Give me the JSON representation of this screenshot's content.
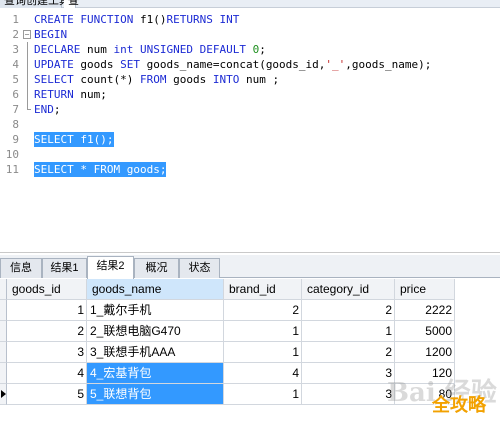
{
  "top_tabs": [
    {
      "label": "查询创建工具"
    },
    {
      "label": "查"
    }
  ],
  "editor": {
    "lines": [
      {
        "n": "1",
        "fold": "none",
        "code": [
          {
            "t": "CREATE FUNCTION",
            "c": "kw"
          },
          {
            "t": " f1()",
            "c": ""
          },
          {
            "t": "RETURNS INT",
            "c": "kw"
          }
        ]
      },
      {
        "n": "2",
        "fold": "box",
        "code": [
          {
            "t": "BEGIN",
            "c": "kw"
          }
        ]
      },
      {
        "n": "3",
        "fold": "vline",
        "code": [
          {
            "t": "DECLARE",
            "c": "kw"
          },
          {
            "t": " num ",
            "c": ""
          },
          {
            "t": "int UNSIGNED DEFAULT",
            "c": "kw"
          },
          {
            "t": " ",
            "c": ""
          },
          {
            "t": "0",
            "c": "num"
          },
          {
            "t": ";",
            "c": ""
          }
        ]
      },
      {
        "n": "4",
        "fold": "vline",
        "code": [
          {
            "t": "UPDATE",
            "c": "kw"
          },
          {
            "t": " goods ",
            "c": ""
          },
          {
            "t": "SET",
            "c": "kw"
          },
          {
            "t": " goods_name=concat(goods_id,",
            "c": ""
          },
          {
            "t": "'_'",
            "c": "str"
          },
          {
            "t": ",goods_name);",
            "c": ""
          }
        ]
      },
      {
        "n": "5",
        "fold": "vline",
        "code": [
          {
            "t": "SELECT",
            "c": "kw"
          },
          {
            "t": " count(*) ",
            "c": ""
          },
          {
            "t": "FROM",
            "c": "kw"
          },
          {
            "t": " goods ",
            "c": ""
          },
          {
            "t": "INTO",
            "c": "kw"
          },
          {
            "t": " num ;",
            "c": ""
          }
        ]
      },
      {
        "n": "6",
        "fold": "vline",
        "code": [
          {
            "t": "RETURN",
            "c": "kw"
          },
          {
            "t": " num;",
            "c": ""
          }
        ]
      },
      {
        "n": "7",
        "fold": "end",
        "code": [
          {
            "t": "END",
            "c": "kw"
          },
          {
            "t": ";",
            "c": ""
          }
        ]
      },
      {
        "n": "8",
        "fold": "none",
        "code": []
      },
      {
        "n": "9",
        "fold": "none",
        "selected": true,
        "code": [
          {
            "t": "SELECT",
            "c": "kw"
          },
          {
            "t": " f1();",
            "c": ""
          }
        ]
      },
      {
        "n": "10",
        "fold": "none",
        "selected": true,
        "code": []
      },
      {
        "n": "11",
        "fold": "none",
        "selected": true,
        "code": [
          {
            "t": "SELECT",
            "c": "kw"
          },
          {
            "t": " * ",
            "c": ""
          },
          {
            "t": "FROM",
            "c": "kw"
          },
          {
            "t": " goods;",
            "c": ""
          }
        ]
      }
    ]
  },
  "result_tabs": [
    {
      "label": "信息",
      "active": false
    },
    {
      "label": "结果1",
      "active": false
    },
    {
      "label": "结果2",
      "active": true
    },
    {
      "label": "概况",
      "active": false
    },
    {
      "label": "状态",
      "active": false
    }
  ],
  "grid": {
    "columns": [
      "goods_id",
      "goods_name",
      "brand_id",
      "category_id",
      "price"
    ],
    "selected_column": "goods_name",
    "rows": [
      {
        "goods_id": "1",
        "goods_name": "1_戴尔手机",
        "brand_id": "2",
        "category_id": "2",
        "price": "2222"
      },
      {
        "goods_id": "2",
        "goods_name": "2_联想电脑G470",
        "brand_id": "1",
        "category_id": "1",
        "price": "5000"
      },
      {
        "goods_id": "3",
        "goods_name": "3_联想手机AAA",
        "brand_id": "1",
        "category_id": "2",
        "price": "1200"
      },
      {
        "goods_id": "4",
        "goods_name": "4_宏基背包",
        "brand_id": "4",
        "category_id": "3",
        "price": "120"
      },
      {
        "goods_id": "5",
        "goods_name": "5_联想背包",
        "brand_id": "1",
        "category_id": "3",
        "price": "80"
      }
    ],
    "current_row": 4,
    "highlight_cells": [
      [
        3,
        "goods_name"
      ],
      [
        4,
        "goods_name"
      ]
    ]
  },
  "watermark": {
    "text": "Bai 经验",
    "logo": "全攻略"
  }
}
